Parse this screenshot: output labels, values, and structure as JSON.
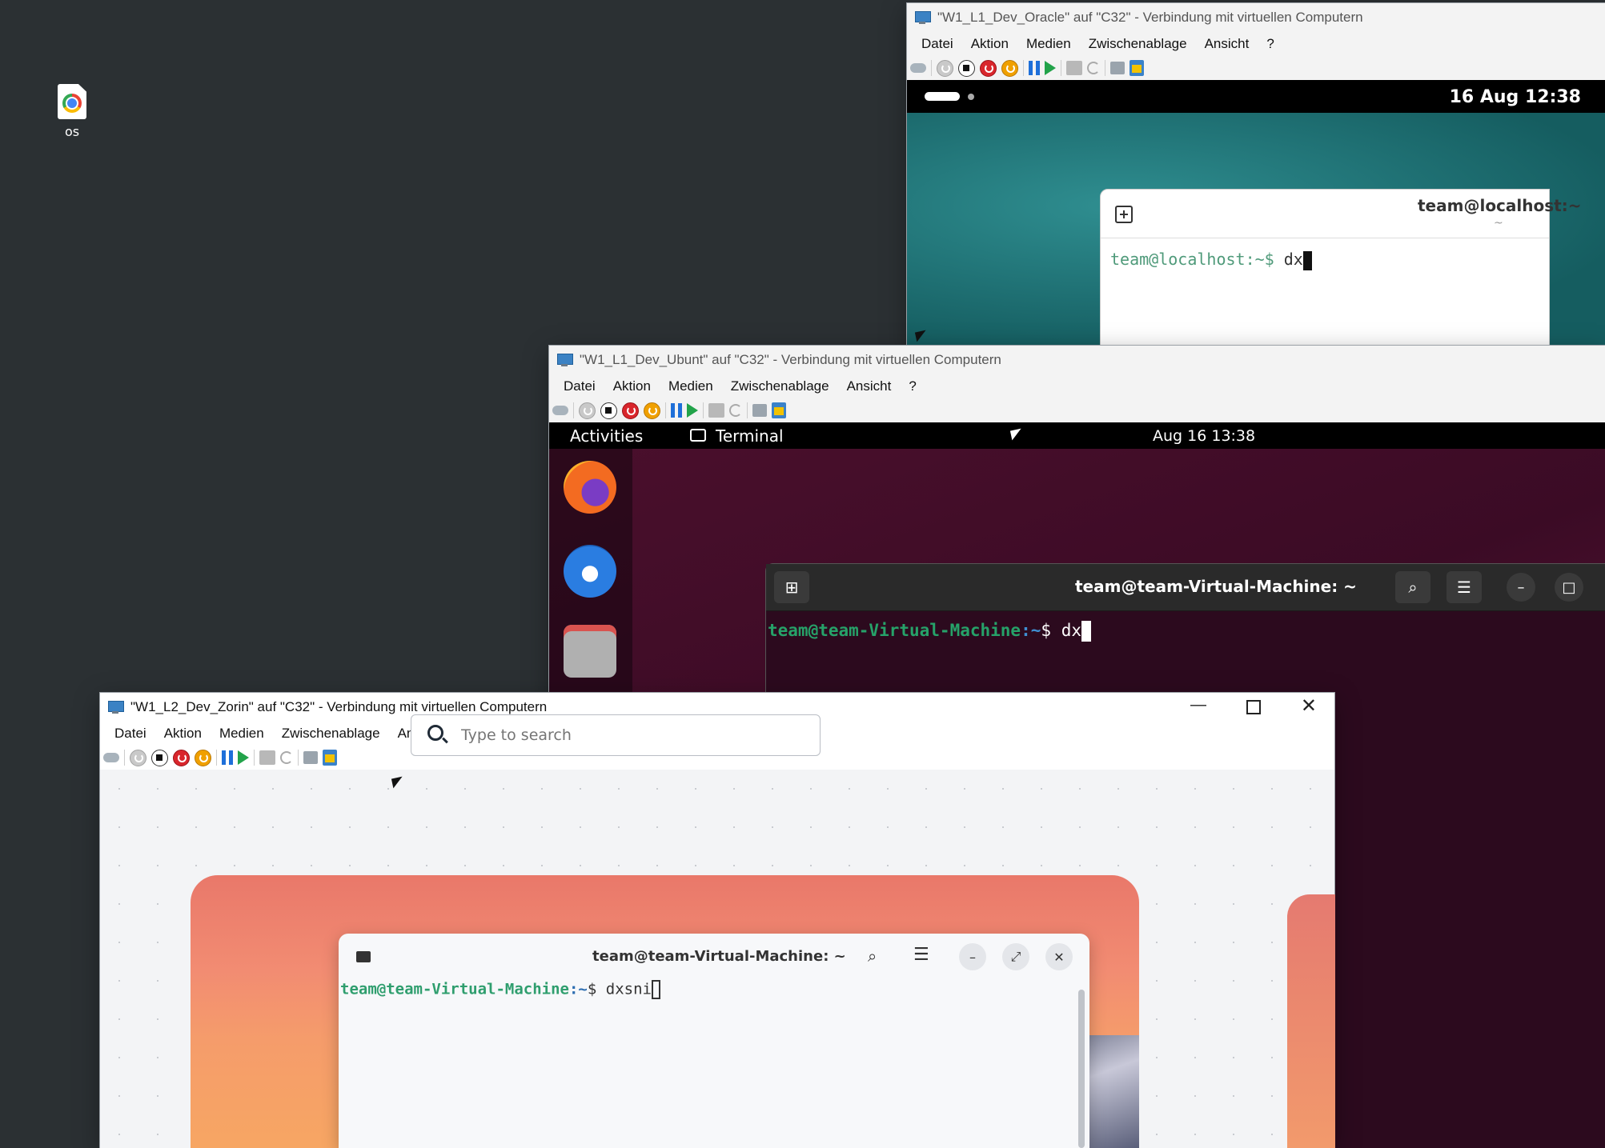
{
  "desktop": {
    "icon_label": "os"
  },
  "oracle_window": {
    "title": "\"W1_L1_Dev_Oracle\" auf \"C32\" - Verbindung mit virtuellen Computern",
    "menu": [
      "Datei",
      "Aktion",
      "Medien",
      "Zwischenablage",
      "Ansicht",
      "?"
    ],
    "topbar_clock": "16 Aug 12:38",
    "terminal_title": "team@localhost:~",
    "terminal_subtitle": "~",
    "prompt": "team@localhost:~$",
    "command": "dx"
  },
  "ubuntu_window": {
    "title": "\"W1_L1_Dev_Ubunt\" auf \"C32\" - Verbindung mit virtuellen Computern",
    "menu": [
      "Datei",
      "Aktion",
      "Medien",
      "Zwischenablage",
      "Ansicht",
      "?"
    ],
    "activities": "Activities",
    "app_name": "Terminal",
    "clock": "Aug 16  13:38",
    "terminal_title": "team@team-Virtual-Machine: ~",
    "prompt_user": "team@team-Virtual-Machine",
    "prompt_path": ":~",
    "prompt_symbol": "$",
    "command": "dx"
  },
  "zorin_window": {
    "title": "\"W1_L2_Dev_Zorin\" auf \"C32\" - Verbindung mit virtuellen Computern",
    "menu": [
      "Datei",
      "Aktion",
      "Medien",
      "Zwischenablage",
      "Ansicht",
      "?"
    ],
    "search_placeholder": "Type to search",
    "terminal_title": "team@team-Virtual-Machine: ~",
    "prompt_user": "team@team-Virtual-Machine",
    "prompt_path": ":~",
    "prompt_symbol": "$",
    "command": "dxsni"
  },
  "colors": {
    "desktop_bg": "#2b3033",
    "ubuntu_prompt_green": "#26a269",
    "zorin_prompt_green": "#2f9e6e"
  }
}
